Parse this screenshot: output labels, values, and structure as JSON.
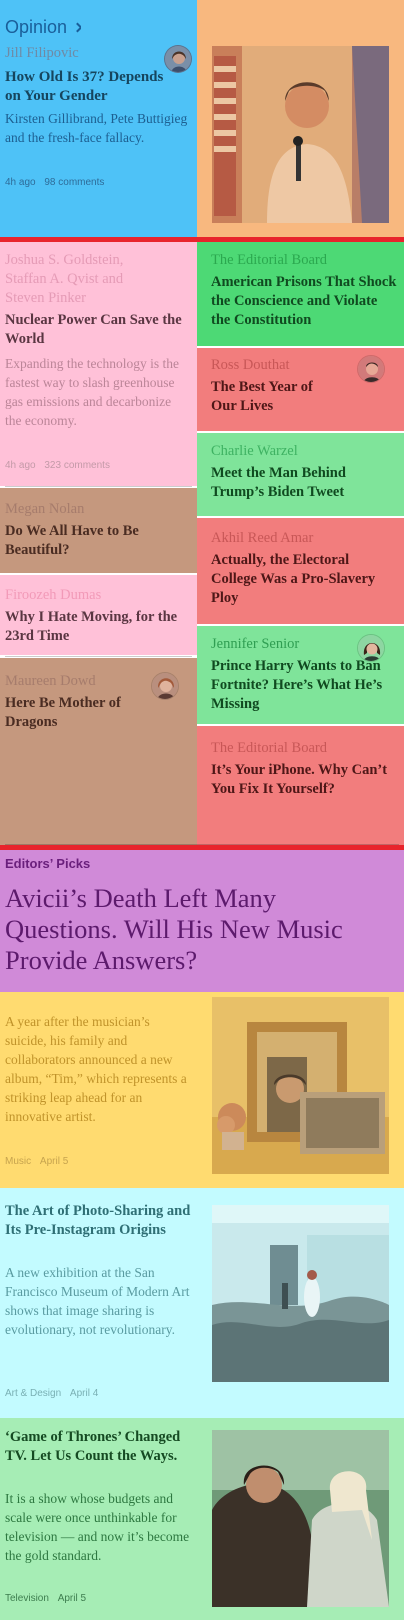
{
  "colors": {
    "blue": "#4ec2f7",
    "orange": "#f8b87f",
    "pink": "#ffc1d8",
    "green": "#4dd975",
    "red": "#f27d7d",
    "lightgreen": "#7fe49a",
    "brown": "#c5987e",
    "purple": "#d08ad8",
    "yellow": "#ffdb70",
    "cyan": "#c3fbff",
    "mint": "#a6edb5",
    "rule": "#e8242c"
  },
  "opinion": {
    "section_label": "Opinion",
    "chevron": "chevron-right-icon",
    "lead": {
      "author": "Jill Filipovic",
      "headline": "How Old Is 37? Depends on Your Gender",
      "summary": "Kirsten Gillibrand, Pete Buttigieg and the fresh-face fallacy.",
      "time": "4h ago",
      "comments": "98 comments",
      "image": "man-speaking-with-microphone-photo"
    },
    "left_column": [
      {
        "author": "Joshua S. Goldstein, Staffan A. Qvist and Steven Pinker",
        "headline": "Nuclear Power Can Save the World",
        "summary": "Expanding the technology is the fastest way to slash greenhouse gas emissions and decarbonize the economy.",
        "time": "4h ago",
        "comments": "323 comments"
      },
      {
        "author": "Megan Nolan",
        "headline": "Do We All Have to Be Beautiful?"
      },
      {
        "author": "Firoozeh Dumas",
        "headline": "Why I Hate Moving, for the 23rd Time"
      },
      {
        "author": "Maureen Dowd",
        "headline": "Here Be Mother of Dragons"
      }
    ],
    "right_column": [
      {
        "author": "The Editorial Board",
        "headline": "American Prisons That Shock the Conscience and Violate the Constitution"
      },
      {
        "author": "Ross Douthat",
        "headline": "The Best Year of Our Lives"
      },
      {
        "author": "Charlie Warzel",
        "headline": "Meet the Man Behind Trump’s Biden Tweet"
      },
      {
        "author": "Akhil Reed Amar",
        "headline": "Actually, the Electoral College Was a Pro-Slavery Ploy"
      },
      {
        "author": "Jennifer Senior",
        "headline": "Prince Harry Wants to Ban Fortnite? Here’s What He’s Missing"
      },
      {
        "author": "The Editorial Board",
        "headline": "It’s Your iPhone. Why Can’t You Fix It Yourself?"
      }
    ]
  },
  "editors_picks": {
    "section_label": "Editors’ Picks",
    "lead_headline": "Avicii’s Death Left Many Questions. Will His New Music Provide Answers?",
    "items": [
      {
        "summary": "A year after the musician’s suicide, his family and collaborators announced a new album, “Tim,” which represents a striking leap ahead for an innovative artist.",
        "section": "Music",
        "date": "April 5",
        "image": "framed-photos-on-shelf-photo"
      },
      {
        "headline": "The Art of Photo-Sharing and Its Pre-Instagram Origins",
        "summary": "A new exhibition at the San Francisco Museum of Modern Art shows that image sharing is evolutionary, not revolutionary.",
        "section": "Art & Design",
        "date": "April 4",
        "image": "gallery-installation-photo"
      },
      {
        "headline": "‘Game of Thrones’ Changed TV. Let Us Count the Ways.",
        "summary": "It is a show whose budgets and scale were once unthinkable for television — and now it’s become the gold standard.",
        "section": "Television",
        "date": "April 5",
        "image": "two-characters-in-fur-photo"
      }
    ]
  }
}
